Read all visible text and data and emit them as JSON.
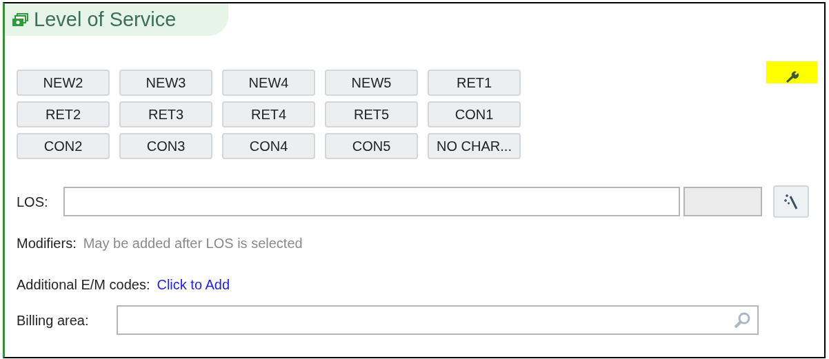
{
  "panel": {
    "title": "Level of Service"
  },
  "code_buttons": [
    "NEW2",
    "NEW3",
    "NEW4",
    "NEW5",
    "RET1",
    "RET2",
    "RET3",
    "RET4",
    "RET5",
    "CON1",
    "CON2",
    "CON3",
    "CON4",
    "CON5",
    "NO CHAR..."
  ],
  "los": {
    "label": "LOS:"
  },
  "modifiers": {
    "label": "Modifiers:",
    "hint": "May be added after LOS is selected"
  },
  "additional_codes": {
    "label": "Additional E/M codes:",
    "link": "Click to Add"
  },
  "billing_area": {
    "label": "Billing area:"
  }
}
